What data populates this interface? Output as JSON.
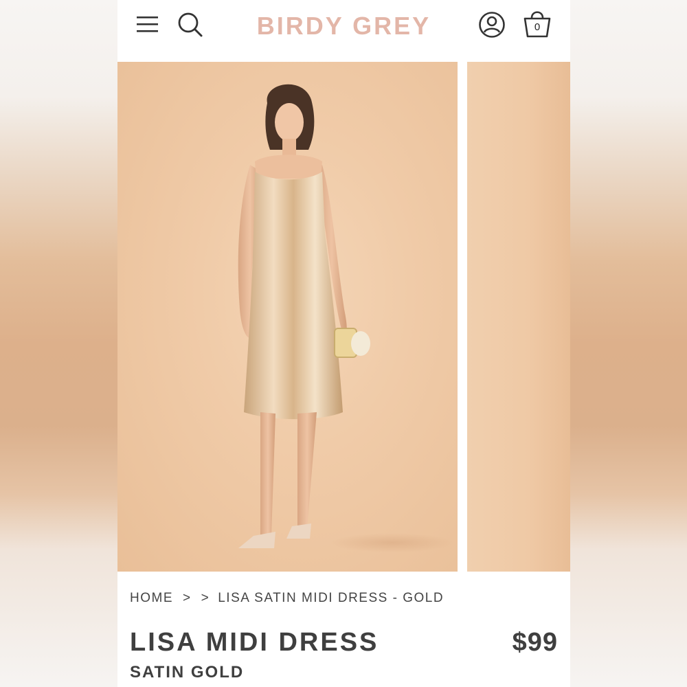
{
  "brand": {
    "name": "BIRDY GREY",
    "color": "#e3b6a8"
  },
  "header": {
    "icons": [
      "menu-icon",
      "search-icon",
      "account-icon",
      "bag-icon"
    ],
    "bag_count": "0"
  },
  "breadcrumb": {
    "home": "HOME",
    "separator": ">",
    "current": "LISA SATIN MIDI DRESS - GOLD"
  },
  "product": {
    "name": "LISA MIDI DRESS",
    "variant": "SATIN GOLD",
    "price": "$99"
  }
}
